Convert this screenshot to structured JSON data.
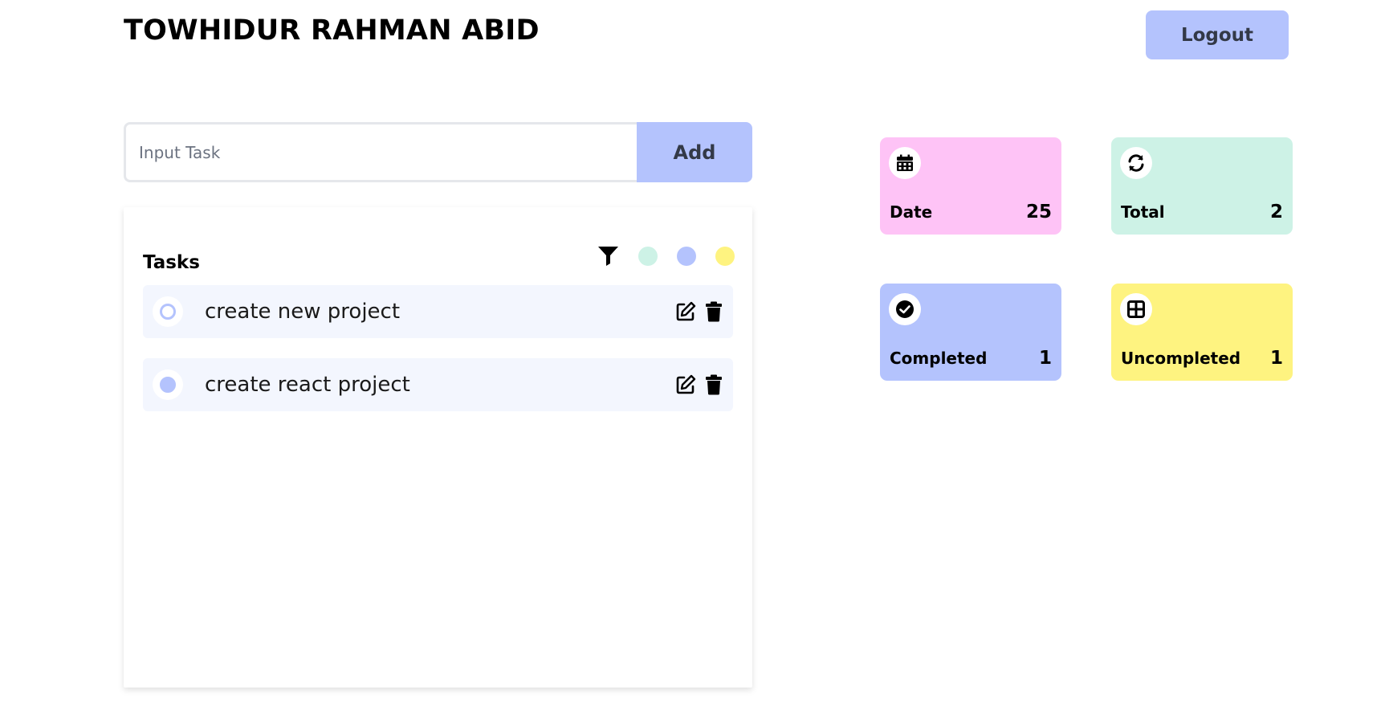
{
  "header": {
    "user_name": "TOWHIDUR RAHMAN ABID",
    "logout_label": "Logout"
  },
  "task_form": {
    "placeholder": "Input Task",
    "value": "",
    "add_label": "Add"
  },
  "task_panel": {
    "title": "Tasks",
    "filter_icon": "filter-icon",
    "filter_colors": [
      "#cdf2e6",
      "#b4c3fd",
      "#fef380"
    ]
  },
  "tasks": [
    {
      "text": "create new project",
      "completed": false
    },
    {
      "text": "create react project",
      "completed": true
    }
  ],
  "stats": {
    "date": {
      "label": "Date",
      "value": "25",
      "icon": "calendar-icon",
      "color": "#fec3f6"
    },
    "total": {
      "label": "Total",
      "value": "2",
      "icon": "refresh-icon",
      "color": "#cdf2e6"
    },
    "completed": {
      "label": "Completed",
      "value": "1",
      "icon": "check-circle-icon",
      "color": "#b4c3fd"
    },
    "uncompleted": {
      "label": "Uncompleted",
      "value": "1",
      "icon": "table-icon",
      "color": "#fef380"
    }
  },
  "colors": {
    "accent": "#b4c3fd",
    "task_bg": "#f3f6fe"
  }
}
